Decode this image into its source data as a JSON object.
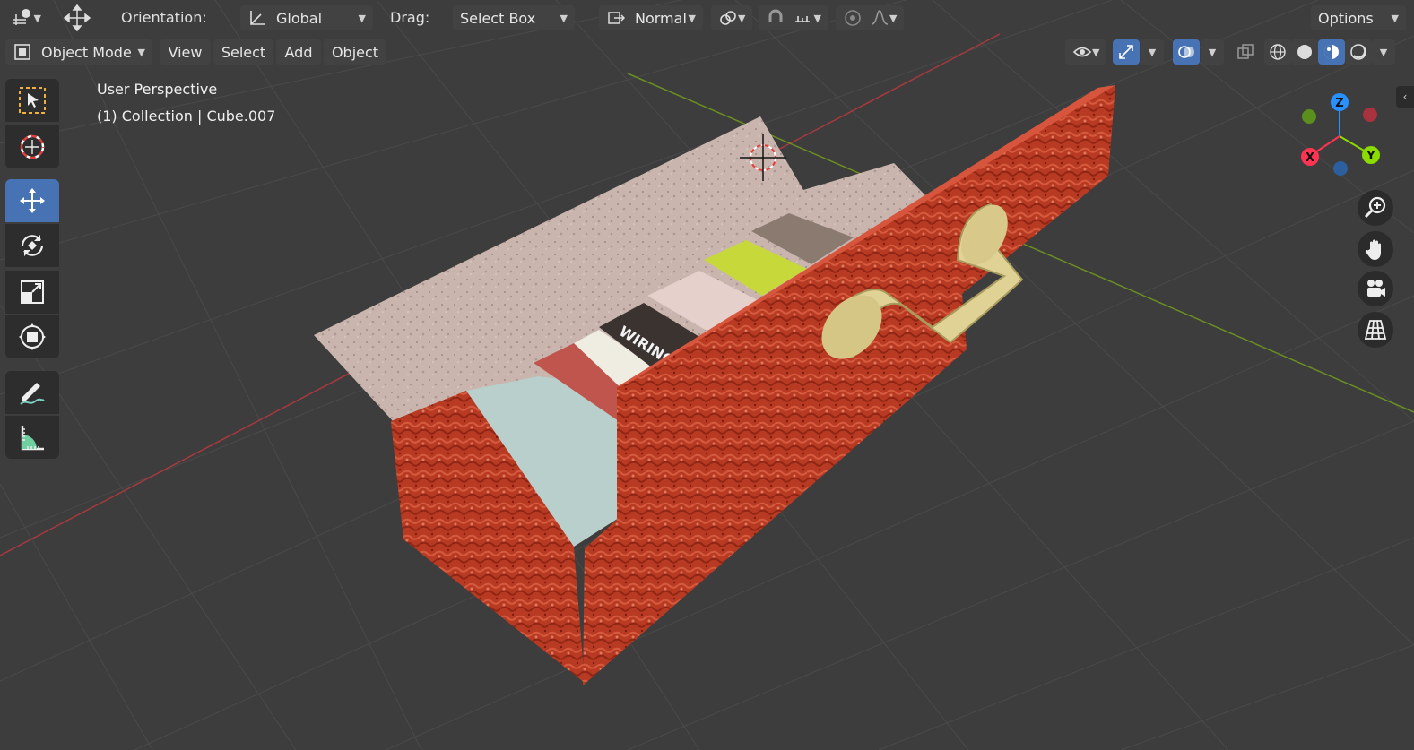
{
  "header": {
    "orientation_label": "Orientation:",
    "orientation_value": "Global",
    "drag_label": "Drag:",
    "drag_value": "Select Box",
    "pivot_value": "Normal",
    "options_label": "Options"
  },
  "menubar": {
    "mode": "Object Mode",
    "items": [
      "View",
      "Select",
      "Add",
      "Object"
    ]
  },
  "viewport": {
    "perspective": "User Perspective",
    "collection": "(1) Collection | Cube.007"
  },
  "gizmo": {
    "axes": [
      "Z",
      "Y",
      "X"
    ],
    "colors": {
      "x": "#ff3352",
      "y": "#8bdc00",
      "z": "#2890ff"
    }
  },
  "tools": [
    "select-box",
    "cursor",
    "move",
    "rotate",
    "scale",
    "transform",
    "annotate",
    "measure"
  ],
  "scene_labels": {
    "book_text": "WIRING"
  },
  "colors": {
    "background": "#3d3d3d",
    "accent": "#4772b3",
    "grid": "#4a4a4a"
  }
}
